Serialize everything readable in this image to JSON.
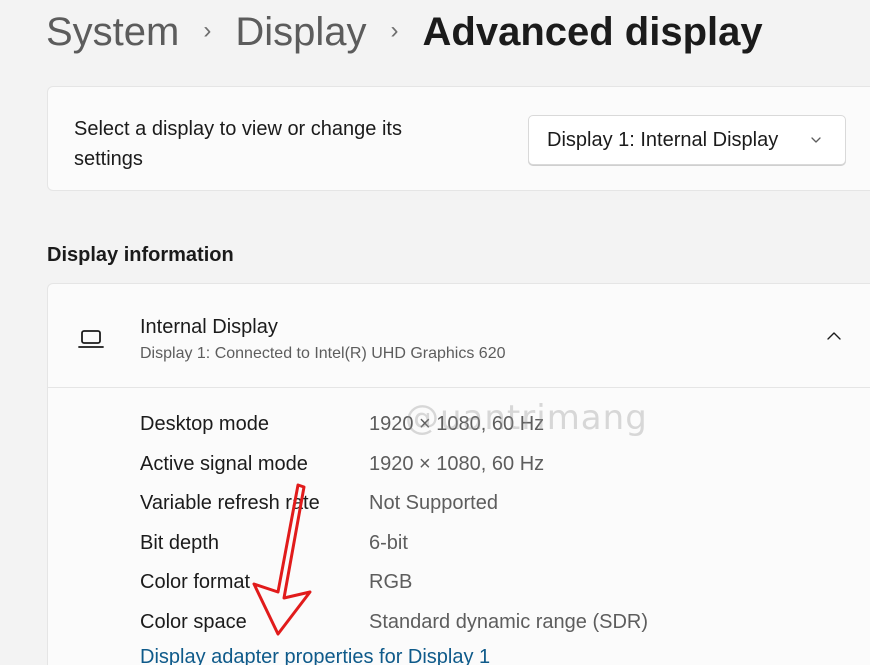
{
  "breadcrumb": {
    "items": [
      "System",
      "Display",
      "Advanced display"
    ],
    "separator": "›"
  },
  "select_display": {
    "label": "Select a display to view or change its settings",
    "dropdown_value": "Display 1: Internal Display",
    "dropdown_icon": "chevron-down-icon"
  },
  "display_information": {
    "heading": "Display information",
    "device": {
      "icon": "laptop-icon",
      "title": "Internal Display",
      "subtitle": "Display 1: Connected to Intel(R) UHD Graphics 620",
      "expanded": true,
      "toggle_icon": "chevron-up-icon"
    },
    "rows": [
      {
        "label": "Desktop mode",
        "value": "1920 × 1080, 60 Hz"
      },
      {
        "label": "Active signal mode",
        "value": "1920 × 1080, 60 Hz"
      },
      {
        "label": "Variable refresh rate",
        "value": "Not Supported"
      },
      {
        "label": "Bit depth",
        "value": "6-bit"
      },
      {
        "label": "Color format",
        "value": "RGB"
      },
      {
        "label": "Color space",
        "value": "Standard dynamic range (SDR)"
      }
    ],
    "adapter_link": "Display adapter properties for Display 1"
  },
  "watermark": "@uantrimang",
  "colors": {
    "link": "#0e5a8a",
    "arrow": "#e11b1b",
    "background": "#f3f3f3",
    "card": "#fbfbfb"
  }
}
